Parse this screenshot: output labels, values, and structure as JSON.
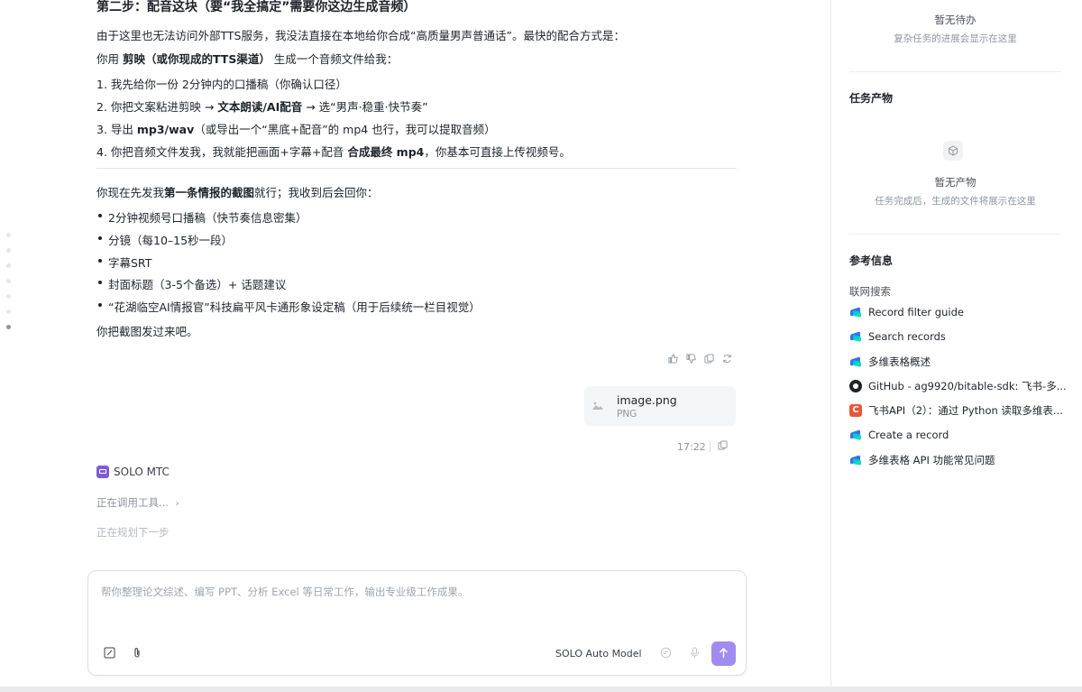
{
  "chat": {
    "heading": "第二步：配音这块（要“我全搞定”需要你这边生成音频）",
    "intro": "由于这里也无法访问外部TTS服务，我没法直接在本地给你合成“高质量男声普通话”。最快的配合方式是：",
    "use_prefix": "你用 ",
    "use_bold": "剪映（或你现成的TTS渠道）",
    "use_suffix": " 生成一个音频文件给我：",
    "steps": [
      {
        "pre": "1. 我先给你一份 2分钟内的口播稿（你确认口径）",
        "bold": "",
        "post": ""
      },
      {
        "pre": "2. 你把文案粘进剪映 → ",
        "bold": "文本朗读/AI配音",
        "post": " → 选“男声·稳重·快节奏”"
      },
      {
        "pre": "3. 导出 ",
        "bold": "mp3/wav",
        "post": "（或导出一个“黑底+配音”的 mp4 也行，我可以提取音频）"
      },
      {
        "pre": "4. 你把音频文件发我，我就能把画面+字幕+配音 ",
        "bold": "合成最终 mp4",
        "post": "，你基本可直接上传视频号。"
      }
    ],
    "request_prefix": "你现在先发我",
    "request_bold": "第一条情报的截图",
    "request_suffix": "就行；我收到后会回你：",
    "deliverables": [
      "2分钟视频号口播稿（快节奏信息密集）",
      "分镜（每10–15秒一段）",
      "字幕SRT",
      "封面标题（3-5个备选）+ 话题建议",
      "“花湖临空AI情报官”科技扁平风卡通形象设定稿（用于后续统一栏目视觉）"
    ],
    "closing": "你把截图发过来吧。",
    "attachment": {
      "name": "image.png",
      "type": "PNG"
    },
    "time": "17:22",
    "agent_name": "SOLO MTC",
    "status_calling": "正在调用工具...",
    "status_planning": "正在规划下一步"
  },
  "composer": {
    "placeholder": "帮你整理论文综述、编写 PPT、分析 Excel 等日常工作，输出专业级工作成果。",
    "model": "SOLO Auto Model"
  },
  "sidebar": {
    "todo_title": "暂无待办",
    "todo_hint": "复杂任务的进展会显示在这里",
    "artifacts_title": "任务产物",
    "artifacts_empty": "暂无产物",
    "artifacts_hint": "任务完成后，生成的文件将展示在这里",
    "refs_title": "参考信息",
    "refs_sub": "联网搜索",
    "refs": [
      {
        "icon": "feishu-icon",
        "label": "Record filter guide"
      },
      {
        "icon": "feishu-icon",
        "label": "Search records"
      },
      {
        "icon": "feishu-icon",
        "label": "多维表格概述"
      },
      {
        "icon": "github-icon",
        "label": "GitHub - ag9920/bitable-sdk: 飞书-多..."
      },
      {
        "icon": "csdn-icon",
        "label": "飞书API（2）：通过 Python 读取多维表..."
      },
      {
        "icon": "feishu-icon",
        "label": "Create a record"
      },
      {
        "icon": "feishu-icon",
        "label": "多维表格 API 功能常见问题"
      }
    ]
  },
  "colors": {
    "accent": "#a08bf0",
    "agent_logo": "#7b5cd6",
    "text": "#1f2329",
    "muted": "#8f959e"
  }
}
